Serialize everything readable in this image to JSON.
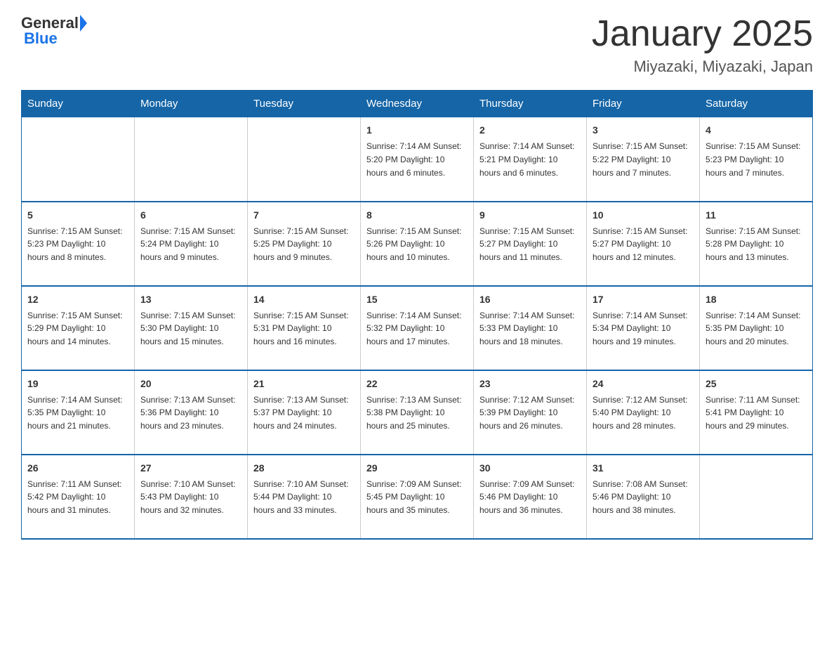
{
  "logo": {
    "general": "General",
    "blue": "Blue"
  },
  "title": "January 2025",
  "subtitle": "Miyazaki, Miyazaki, Japan",
  "days_of_week": [
    "Sunday",
    "Monday",
    "Tuesday",
    "Wednesday",
    "Thursday",
    "Friday",
    "Saturday"
  ],
  "weeks": [
    [
      {
        "day": "",
        "info": ""
      },
      {
        "day": "",
        "info": ""
      },
      {
        "day": "",
        "info": ""
      },
      {
        "day": "1",
        "info": "Sunrise: 7:14 AM\nSunset: 5:20 PM\nDaylight: 10 hours and 6 minutes."
      },
      {
        "day": "2",
        "info": "Sunrise: 7:14 AM\nSunset: 5:21 PM\nDaylight: 10 hours and 6 minutes."
      },
      {
        "day": "3",
        "info": "Sunrise: 7:15 AM\nSunset: 5:22 PM\nDaylight: 10 hours and 7 minutes."
      },
      {
        "day": "4",
        "info": "Sunrise: 7:15 AM\nSunset: 5:23 PM\nDaylight: 10 hours and 7 minutes."
      }
    ],
    [
      {
        "day": "5",
        "info": "Sunrise: 7:15 AM\nSunset: 5:23 PM\nDaylight: 10 hours and 8 minutes."
      },
      {
        "day": "6",
        "info": "Sunrise: 7:15 AM\nSunset: 5:24 PM\nDaylight: 10 hours and 9 minutes."
      },
      {
        "day": "7",
        "info": "Sunrise: 7:15 AM\nSunset: 5:25 PM\nDaylight: 10 hours and 9 minutes."
      },
      {
        "day": "8",
        "info": "Sunrise: 7:15 AM\nSunset: 5:26 PM\nDaylight: 10 hours and 10 minutes."
      },
      {
        "day": "9",
        "info": "Sunrise: 7:15 AM\nSunset: 5:27 PM\nDaylight: 10 hours and 11 minutes."
      },
      {
        "day": "10",
        "info": "Sunrise: 7:15 AM\nSunset: 5:27 PM\nDaylight: 10 hours and 12 minutes."
      },
      {
        "day": "11",
        "info": "Sunrise: 7:15 AM\nSunset: 5:28 PM\nDaylight: 10 hours and 13 minutes."
      }
    ],
    [
      {
        "day": "12",
        "info": "Sunrise: 7:15 AM\nSunset: 5:29 PM\nDaylight: 10 hours and 14 minutes."
      },
      {
        "day": "13",
        "info": "Sunrise: 7:15 AM\nSunset: 5:30 PM\nDaylight: 10 hours and 15 minutes."
      },
      {
        "day": "14",
        "info": "Sunrise: 7:15 AM\nSunset: 5:31 PM\nDaylight: 10 hours and 16 minutes."
      },
      {
        "day": "15",
        "info": "Sunrise: 7:14 AM\nSunset: 5:32 PM\nDaylight: 10 hours and 17 minutes."
      },
      {
        "day": "16",
        "info": "Sunrise: 7:14 AM\nSunset: 5:33 PM\nDaylight: 10 hours and 18 minutes."
      },
      {
        "day": "17",
        "info": "Sunrise: 7:14 AM\nSunset: 5:34 PM\nDaylight: 10 hours and 19 minutes."
      },
      {
        "day": "18",
        "info": "Sunrise: 7:14 AM\nSunset: 5:35 PM\nDaylight: 10 hours and 20 minutes."
      }
    ],
    [
      {
        "day": "19",
        "info": "Sunrise: 7:14 AM\nSunset: 5:35 PM\nDaylight: 10 hours and 21 minutes."
      },
      {
        "day": "20",
        "info": "Sunrise: 7:13 AM\nSunset: 5:36 PM\nDaylight: 10 hours and 23 minutes."
      },
      {
        "day": "21",
        "info": "Sunrise: 7:13 AM\nSunset: 5:37 PM\nDaylight: 10 hours and 24 minutes."
      },
      {
        "day": "22",
        "info": "Sunrise: 7:13 AM\nSunset: 5:38 PM\nDaylight: 10 hours and 25 minutes."
      },
      {
        "day": "23",
        "info": "Sunrise: 7:12 AM\nSunset: 5:39 PM\nDaylight: 10 hours and 26 minutes."
      },
      {
        "day": "24",
        "info": "Sunrise: 7:12 AM\nSunset: 5:40 PM\nDaylight: 10 hours and 28 minutes."
      },
      {
        "day": "25",
        "info": "Sunrise: 7:11 AM\nSunset: 5:41 PM\nDaylight: 10 hours and 29 minutes."
      }
    ],
    [
      {
        "day": "26",
        "info": "Sunrise: 7:11 AM\nSunset: 5:42 PM\nDaylight: 10 hours and 31 minutes."
      },
      {
        "day": "27",
        "info": "Sunrise: 7:10 AM\nSunset: 5:43 PM\nDaylight: 10 hours and 32 minutes."
      },
      {
        "day": "28",
        "info": "Sunrise: 7:10 AM\nSunset: 5:44 PM\nDaylight: 10 hours and 33 minutes."
      },
      {
        "day": "29",
        "info": "Sunrise: 7:09 AM\nSunset: 5:45 PM\nDaylight: 10 hours and 35 minutes."
      },
      {
        "day": "30",
        "info": "Sunrise: 7:09 AM\nSunset: 5:46 PM\nDaylight: 10 hours and 36 minutes."
      },
      {
        "day": "31",
        "info": "Sunrise: 7:08 AM\nSunset: 5:46 PM\nDaylight: 10 hours and 38 minutes."
      },
      {
        "day": "",
        "info": ""
      }
    ]
  ]
}
